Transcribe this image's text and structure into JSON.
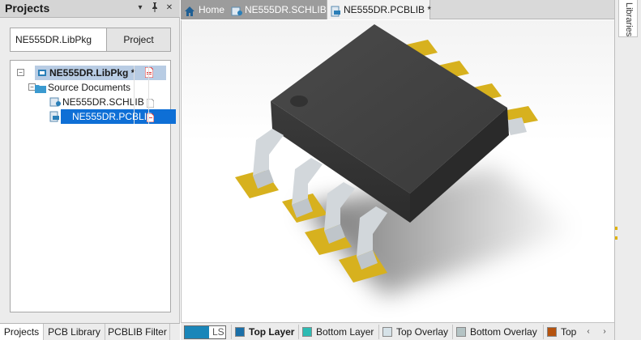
{
  "projects_panel": {
    "title": "Projects",
    "controls": {
      "dropdown": "▾",
      "pin": "📌",
      "close": "✕"
    },
    "project_name_value": "NE555DR.LibPkg",
    "project_button_label": "Project",
    "tree": {
      "library_package": "NE555DR.LibPkg *",
      "source_folder": "Source Documents",
      "schlib": "NE555DR.SCHLIB",
      "pcblib": "NE555DR.PCBLIB"
    },
    "bottom_tabs": [
      "Projects",
      "PCB Library",
      "PCBLIB Filter"
    ]
  },
  "document_tabs": [
    {
      "label": "Home",
      "icon": "home-icon"
    },
    {
      "label": "NE555DR.SCHLIB",
      "icon": "schlib-doc-icon"
    },
    {
      "label": "NE555DR.PCBLIB *",
      "icon": "pcblib-doc-icon"
    }
  ],
  "right_rail": {
    "tab_label": "Libraries"
  },
  "layer_bar": {
    "ls_label": "LS",
    "layers": [
      {
        "label": "Top Layer",
        "color": "#1a6fa8"
      },
      {
        "label": "Bottom Layer",
        "color": "#2dbbb3"
      },
      {
        "label": "Top Overlay",
        "color": "#d6e2e8"
      },
      {
        "label": "Bottom Overlay",
        "color": "#b4c3c4"
      },
      {
        "label": "Top",
        "color": "#b5530f"
      }
    ],
    "scroll_left": "‹",
    "scroll_right": "›"
  },
  "colors": {
    "selected_row": "#0e6fd6",
    "ic_body": "#3d3d3d",
    "pad_gold": "#d7b11e",
    "lead_silver": "#d2d7db"
  }
}
